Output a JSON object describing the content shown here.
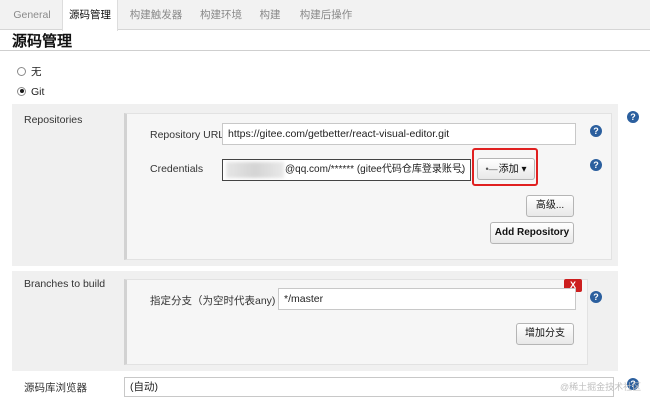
{
  "tabs": [
    {
      "label": "General"
    },
    {
      "label": "源码管理"
    },
    {
      "label": "构建触发器"
    },
    {
      "label": "构建环境"
    },
    {
      "label": "构建"
    },
    {
      "label": "构建后操作"
    }
  ],
  "page_title": "源码管理",
  "scm_options": {
    "none_label": "无",
    "git_label": "Git",
    "selected": "Git"
  },
  "repositories": {
    "section_label": "Repositories",
    "url_label": "Repository URL",
    "url_value": "https://gitee.com/getbetter/react-visual-editor.git",
    "credentials_label": "Credentials",
    "credentials_value": "@qq.com/****** (gitee代码仓库登录账号)",
    "add_button": "添加",
    "advanced_button": "高级...",
    "add_repository_button": "Add Repository"
  },
  "branches": {
    "section_label": "Branches to build",
    "branch_label": "指定分支（为空时代表any)",
    "branch_value": "*/master",
    "delete_label": "X",
    "add_branch_button": "增加分支"
  },
  "browser": {
    "section_label": "源码库浏览器",
    "selected_value": "(自动)"
  },
  "help_glyph": "?",
  "watermark": "@稀土掘金技术社区",
  "colors": {
    "highlight_border": "#e02020",
    "help_icon": "#2b5f9e",
    "delete_button": "#cc1f1f"
  }
}
